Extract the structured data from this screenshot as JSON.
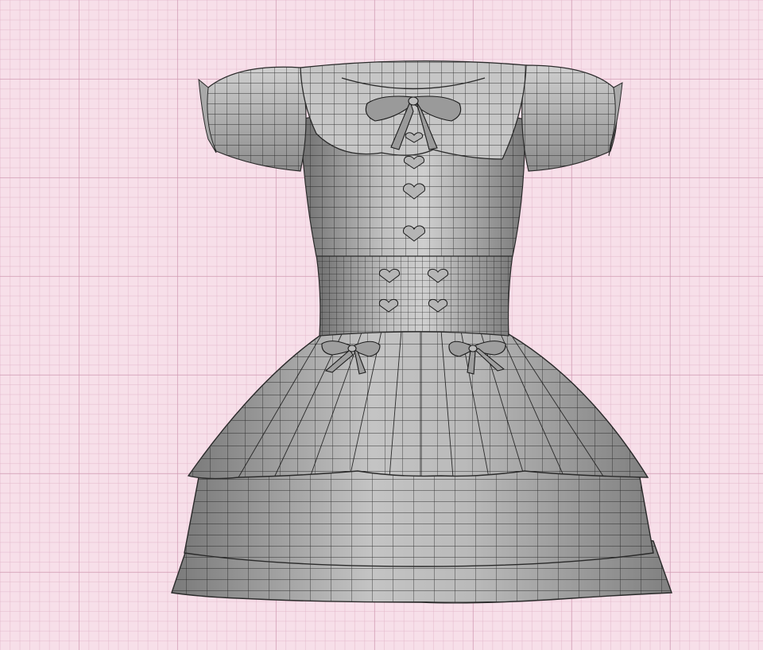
{
  "viewport": {
    "background_color": "#f7dfe9",
    "grid_major_color": "#cd96af",
    "grid_minor_color": "#e1b4c8",
    "mesh_fill": "#9b9b9b",
    "mesh_fill_light": "#c9c9c9",
    "wire_color": "#1c1c1c"
  },
  "model": {
    "object": "dress-mesh",
    "features": [
      "collar",
      "puff-sleeves",
      "heart-buttons",
      "bows",
      "tiered-skirt"
    ]
  }
}
